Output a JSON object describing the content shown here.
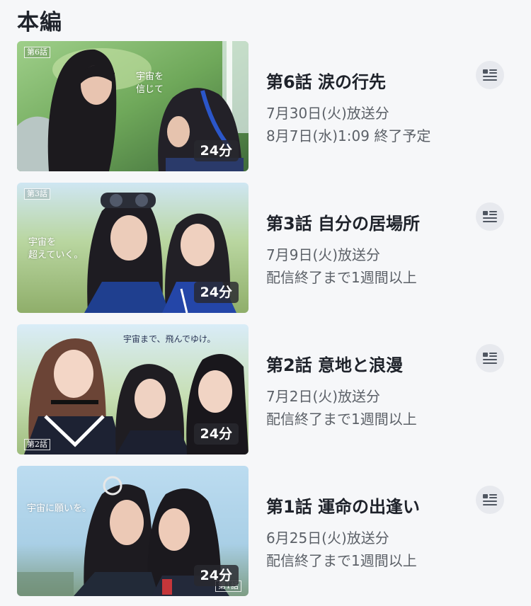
{
  "section": {
    "title": "本編"
  },
  "episodes": [
    {
      "tag": "第6話",
      "caption": "宇宙を\n信じて",
      "duration": "24分",
      "title": "第6話 涙の行先",
      "air": "7月30日(火)放送分",
      "availability": "8月7日(水)1:09 終了予定",
      "detail_icon": "article-list-icon"
    },
    {
      "tag": "第3話",
      "caption": "宇宙を\n超えていく。",
      "duration": "24分",
      "title": "第3話 自分の居場所",
      "air": "7月9日(火)放送分",
      "availability": "配信終了まで1週間以上",
      "detail_icon": "article-list-icon"
    },
    {
      "tag": "第2話",
      "caption": "宇宙まで、飛んでゆけ。",
      "duration": "24分",
      "title": "第2話 意地と浪漫",
      "air": "7月2日(火)放送分",
      "availability": "配信終了まで1週間以上",
      "detail_icon": "article-list-icon"
    },
    {
      "tag": "第1話",
      "caption": "宇宙に願いを。",
      "duration": "24分",
      "title": "第1話 運命の出逢い",
      "air": "6月25日(火)放送分",
      "availability": "配信終了まで1週間以上",
      "detail_icon": "article-list-icon"
    }
  ]
}
